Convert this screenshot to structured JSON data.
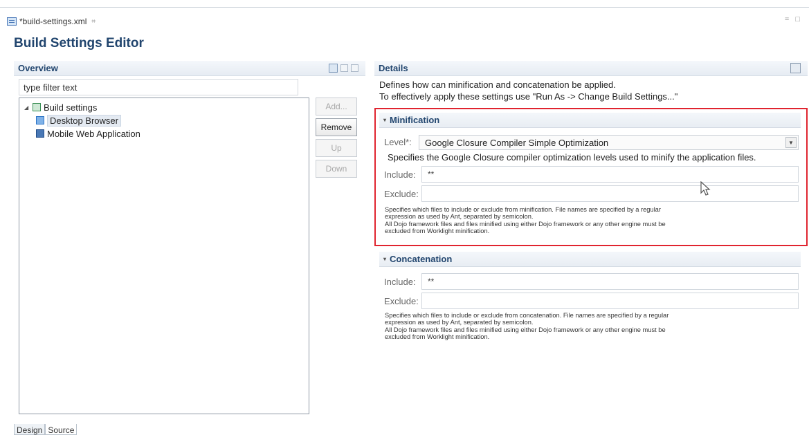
{
  "editor_tab": {
    "title": "*build-settings.xml",
    "close_glyph": "⌗"
  },
  "window_controls": "= □",
  "editor_title": "Build Settings Editor",
  "overview": {
    "title": "Overview",
    "filter_placeholder": "type filter text",
    "tree": {
      "root": "Build settings",
      "children": [
        "Desktop Browser",
        "Mobile Web Application"
      ]
    },
    "buttons": {
      "add": "Add...",
      "remove": "Remove",
      "up": "Up",
      "down": "Down"
    }
  },
  "details": {
    "title": "Details",
    "desc_line1": "Defines how can minification and concatenation be applied.",
    "desc_line2": "To effectively apply these settings use \"Run As -> Change Build Settings...\""
  },
  "minification": {
    "title": "Minification",
    "level_label": "Level*:",
    "level_value": "Google Closure Compiler Simple Optimization",
    "level_desc": "Specifies the Google Closure compiler optimization levels used to minify the application files.",
    "include_label": "Include:",
    "include_value": "**",
    "exclude_label": "Exclude:",
    "exclude_value": "",
    "note": [
      "Specifies which files to include or exclude from minification. File names are specified by a regular",
      "expression as used by Ant, separated by semicolon.",
      "All Dojo framework files and files minified using either Dojo framework or any other engine must be",
      "excluded from Worklight minification."
    ]
  },
  "concatenation": {
    "title": "Concatenation",
    "include_label": "Include:",
    "include_value": "**",
    "exclude_label": "Exclude:",
    "exclude_value": "",
    "note": [
      "Specifies which files to include or exclude from concatenation. File names are specified by a regular",
      "expression as used by Ant, separated by semicolon.",
      "All Dojo framework files and files minified using either Dojo framework or any other engine must be",
      "excluded from Worklight minification."
    ]
  },
  "bottom_tabs": {
    "design": "Design",
    "source": "Source"
  },
  "colors": {
    "header_text": "#21456e",
    "highlight_border": "#e0242f"
  }
}
